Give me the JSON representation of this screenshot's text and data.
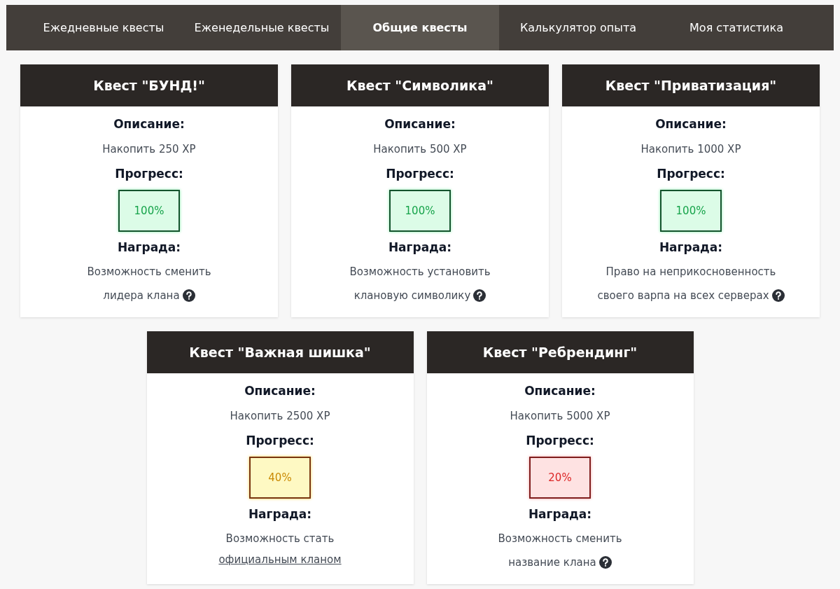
{
  "tabs": [
    {
      "label": "Ежедневные квесты",
      "selected": false
    },
    {
      "label": "Еженедельные квесты",
      "selected": false
    },
    {
      "label": "Общие квесты",
      "selected": true
    },
    {
      "label": "Калькулятор опыта",
      "selected": false
    },
    {
      "label": "Моя статистика",
      "selected": false
    }
  ],
  "quests": [
    {
      "title": "Квест \"БУНД!\"",
      "description_label": "Описание:",
      "description": "Накопить 250 XP",
      "progress_label": "Прогресс:",
      "progress": "100%",
      "kind": "complete",
      "reward_label": "Награда:",
      "reward_lines": [
        "Возможность сменить",
        "лидера клана"
      ],
      "help": true
    },
    {
      "title": "Квест \"Символика\"",
      "description_label": "Описание:",
      "description": "Накопить 500 XP",
      "progress_label": "Прогресс:",
      "progress": "100%",
      "kind": "complete",
      "reward_label": "Награда:",
      "reward_lines": [
        "Возможность установить",
        "клановую символику"
      ],
      "help": true
    },
    {
      "title": "Квест \"Приватизация\"",
      "description_label": "Описание:",
      "description": "Накопить 1000 XP",
      "progress_label": "Прогресс:",
      "progress": "100%",
      "kind": "complete",
      "reward_label": "Награда:",
      "reward_lines": [
        "Право на неприкосновенность",
        "своего варпа на всех серверах"
      ],
      "help": true
    },
    {
      "title": "Квест \"Важная шишка\"",
      "description_label": "Описание:",
      "description": "Накопить 2500 XP",
      "progress_label": "Прогресс:",
      "progress": "40%",
      "kind": "partial",
      "reward_label": "Награда:",
      "reward_lines": [
        "Возможность стать"
      ],
      "reward_link": "официальным кланом",
      "help": false
    },
    {
      "title": "Квест \"Ребрендинг\"",
      "description_label": "Описание:",
      "description": "Накопить 5000 XP",
      "progress_label": "Прогресс:",
      "progress": "20%",
      "kind": "low",
      "reward_label": "Награда:",
      "reward_lines": [
        "Возможность сменить",
        "название клана"
      ],
      "help": true
    }
  ]
}
